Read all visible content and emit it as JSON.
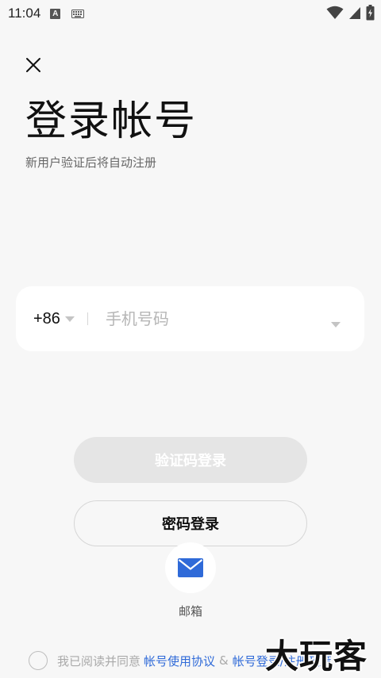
{
  "status_bar": {
    "time": "11:04",
    "left_icons": [
      "a-badge-icon",
      "keyboard-icon"
    ],
    "right_icons": [
      "wifi-icon",
      "signal-icon",
      "battery-charging-icon"
    ],
    "a_badge_text": "A"
  },
  "header": {
    "title": "登录帐号",
    "subtitle": "新用户验证后将自动注册"
  },
  "phone": {
    "country_code": "+86",
    "placeholder": "手机号码",
    "value": ""
  },
  "buttons": {
    "sms_login": "验证码登录",
    "password_login": "密码登录"
  },
  "other_login": {
    "email_label": "邮箱"
  },
  "agreement": {
    "prefix": "我已阅读并同意",
    "link1": "帐号使用协议",
    "amp": "&",
    "link2": "帐号登录/注册政策"
  },
  "watermark": {
    "text": "大玩客"
  },
  "colors": {
    "background": "#f7f7f7",
    "link": "#2f6ad8",
    "email_icon": "#2f6ad8",
    "disabled_button": "#e5e5e5"
  }
}
